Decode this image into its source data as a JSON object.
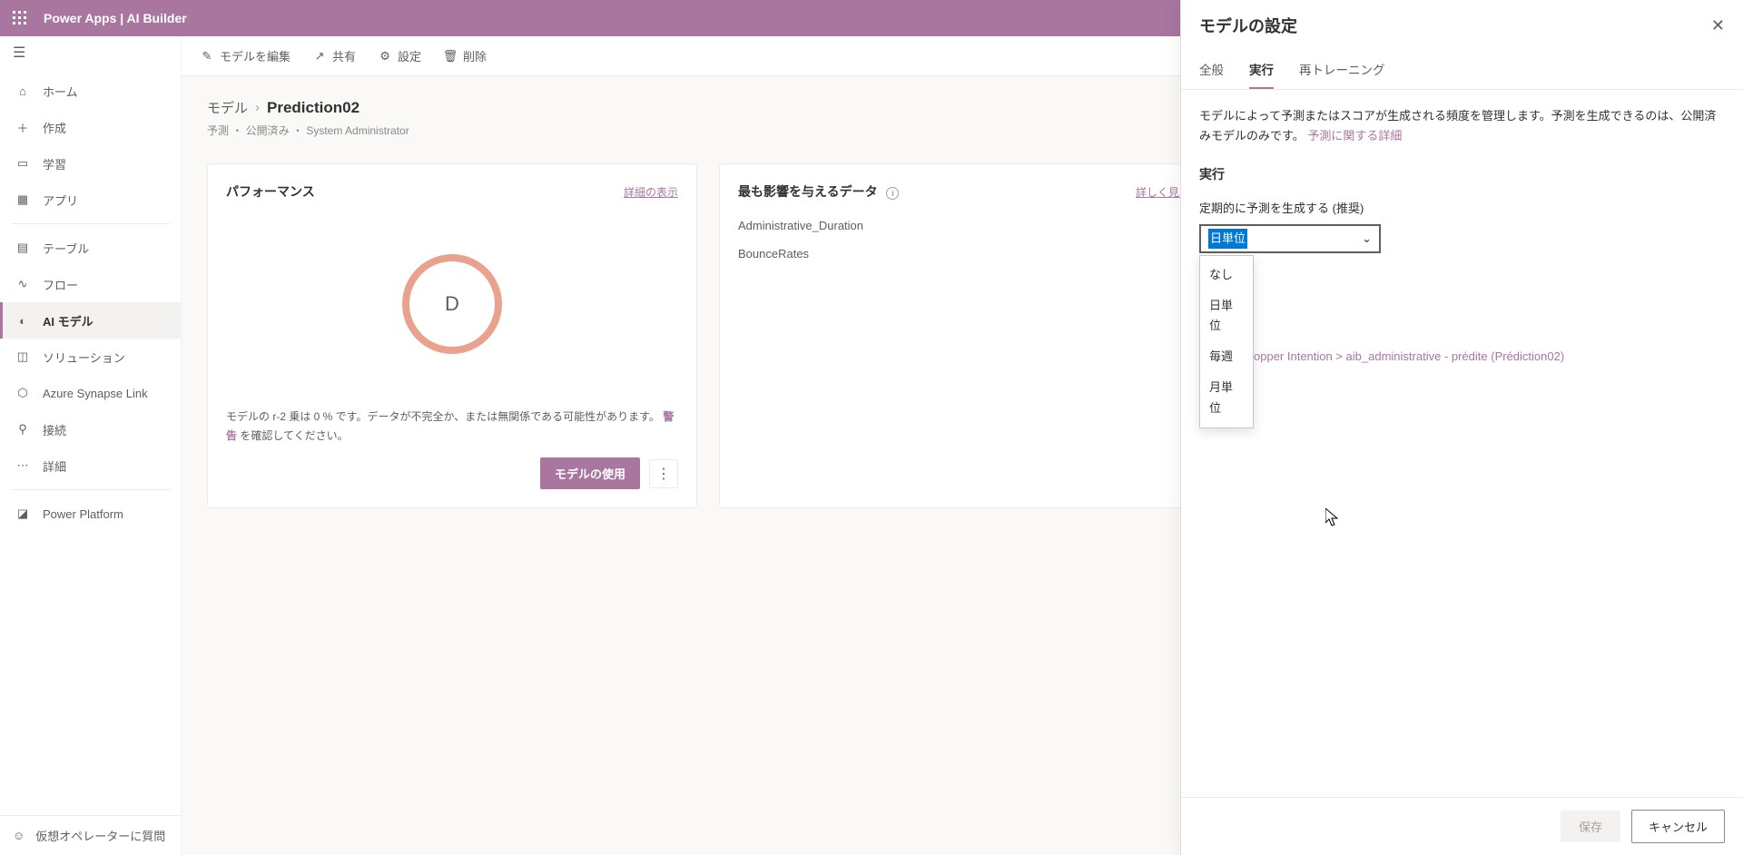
{
  "appbar": {
    "title": "Power Apps  |  AI Builder"
  },
  "nav": {
    "items": [
      "ホーム",
      "作成",
      "学習",
      "アプリ",
      "テーブル",
      "フロー",
      "AI モデル",
      "ソリューション",
      "Azure Synapse Link",
      "接続",
      "詳細",
      "Power Platform"
    ],
    "selected_index": 6,
    "bottom": "仮想オペレーターに質問"
  },
  "toolbar": {
    "edit": "モデルを編集",
    "share": "共有",
    "settings": "設定",
    "delete": "削除"
  },
  "breadcrumb": {
    "root": "モデル",
    "current": "Prediction02"
  },
  "subline": "予測 ・ 公開済み ・ System Administrator",
  "cards": {
    "perf": {
      "title": "パフォーマンス",
      "link": "詳細の表示",
      "grade": "D",
      "note_pre": "モデルの r-2 乗は 0 % です。データが不完全か、または無関係である可能性があります。",
      "warning": "警告",
      "note_post": " を確認してください。",
      "usebtn": "モデルの使用"
    },
    "data": {
      "title": "最も影響を与えるデータ",
      "link": "詳しく見る",
      "rows": [
        "Administrative_Duration",
        "BounceRates"
      ]
    }
  },
  "panel": {
    "title": "モデルの設定",
    "tabs": [
      "全般",
      "実行",
      "再トレーニング"
    ],
    "active_tab": 1,
    "desc": "モデルによって予測またはスコアが生成される頻度を管理します。予測を生成できるのは、公開済みモデルのみです。",
    "desc_link": "予測に関する詳細",
    "section": "実行",
    "field": "定期的に予測を生成する (推奨)",
    "selected": "日単位",
    "options": [
      "なし",
      "日単位",
      "毎週",
      "月単位"
    ],
    "outlink": "opper Intention > aib_administrative - prédite (Prédiction02)",
    "save": "保存",
    "cancel": "キャンセル"
  }
}
